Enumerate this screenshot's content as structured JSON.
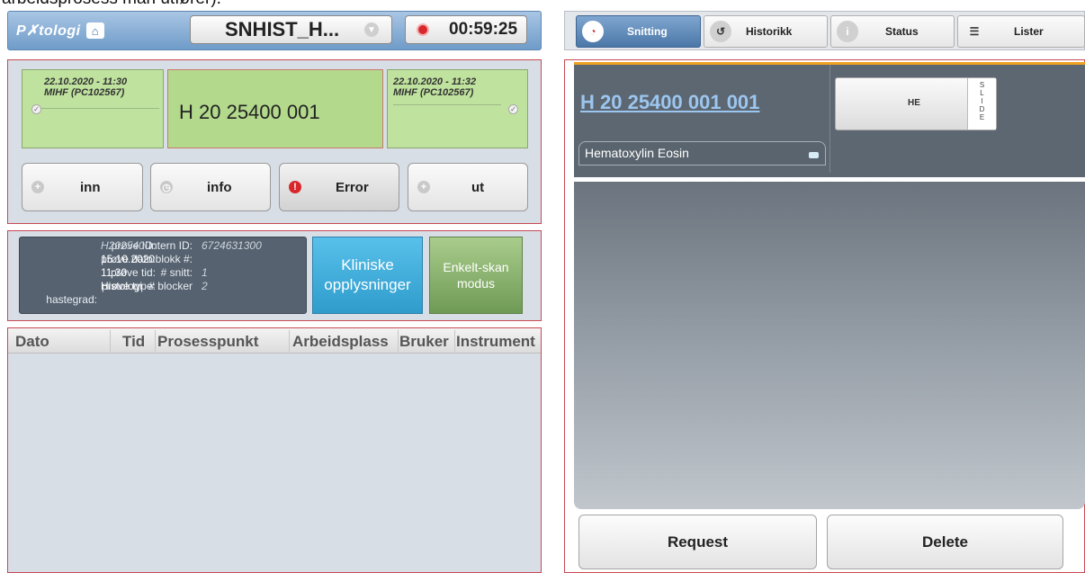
{
  "caption": "arbeidsprosess man utfører).",
  "header": {
    "logo_text": "P✗tologi",
    "selector_value": "SNHIST_H...",
    "timer": "00:59:25"
  },
  "scan": {
    "left": {
      "date": "22.10.2020 - 11:30",
      "station": "MIHF (PC102567)"
    },
    "center_id": "H 20 25400 001",
    "right": {
      "date": "22.10.2020 - 11:32",
      "station": "MIHF (PC102567)"
    }
  },
  "actions": {
    "inn": "inn",
    "info": "info",
    "error": "Error",
    "ut": "ut"
  },
  "sample": {
    "labels": {
      "id": "prøve ID:",
      "dato": "prøve dato:",
      "tid": "prøve tid:",
      "type": "prøve type:",
      "hastegrad": "hastegrad:",
      "intern": "intern ID:",
      "blokk": "blokk #:",
      "snitt": "# snitt:",
      "blocker": "# blocker"
    },
    "values": {
      "id": "H2025400",
      "dato": "15.10.2020",
      "tid": "11:30",
      "type": "Histologi",
      "intern": "6724631300",
      "snitt": "1",
      "blocker": "2"
    }
  },
  "buttons": {
    "kliniske_line1": "Kliniske",
    "kliniske_line2": "opplysninger",
    "enkelt_line1": "Enkelt-skan",
    "enkelt_line2": "modus"
  },
  "table": {
    "columns": [
      "Dato",
      "Tid",
      "Prosesspunkt",
      "Arbeidsplass",
      "Bruker",
      "Instrument"
    ]
  },
  "tabs": [
    "Snitting",
    "Historikk",
    "Status",
    "Lister"
  ],
  "slide": {
    "id": "H 20 25400 001 001",
    "stain": "Hematoxylin Eosin",
    "card_label": "HE",
    "side_text": "S L I D E"
  },
  "bottom_buttons": {
    "request": "Request",
    "delete": "Delete"
  }
}
